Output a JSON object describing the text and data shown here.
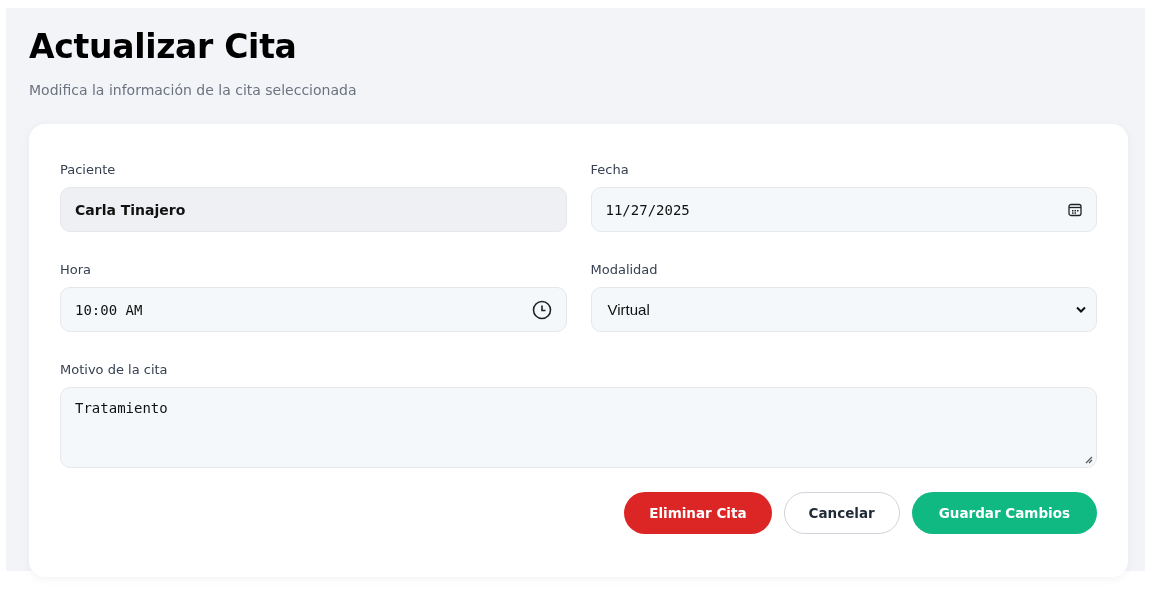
{
  "header": {
    "title": "Actualizar Cita",
    "subtitle": "Modifica la información de la cita seleccionada"
  },
  "fields": [
    {
      "label": "Paciente",
      "value": "Carla Tinajero",
      "kind": "text",
      "disabled": true
    },
    {
      "label": "Fecha",
      "value": "11/27/2025",
      "kind": "date",
      "disabled": false
    },
    {
      "label": "Hora",
      "value": "10:00 AM",
      "kind": "time",
      "disabled": false
    },
    {
      "label": "Modalidad",
      "value": "Virtual",
      "kind": "select",
      "disabled": false
    },
    {
      "label": "Motivo de la cita",
      "value": "Tratamiento",
      "kind": "textarea",
      "disabled": false
    }
  ],
  "buttons": [
    {
      "label": "Eliminar Cita",
      "kind": "danger"
    },
    {
      "label": "Cancelar",
      "kind": "secondary"
    },
    {
      "label": "Guardar Cambios",
      "kind": "primary"
    }
  ]
}
